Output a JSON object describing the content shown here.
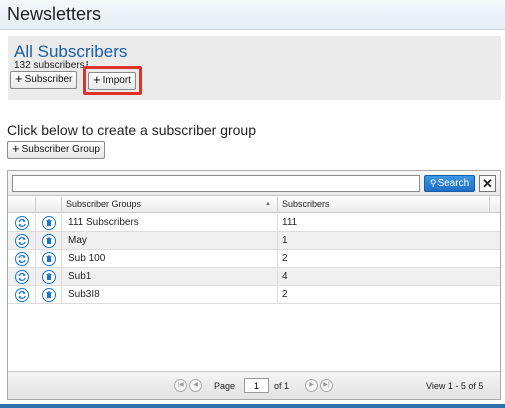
{
  "header": {
    "title": "Newsletters"
  },
  "panel": {
    "title": "All Subscribers",
    "count_text": "132 subscribers",
    "add_subscriber_label": "Subscriber",
    "import_label": "Import"
  },
  "group_section": {
    "heading": "Click below to create a subscriber group",
    "add_group_label": "Subscriber Group"
  },
  "grid": {
    "search_value": "",
    "search_label": "Search",
    "clear_label": "✕",
    "columns": {
      "groups": "Subscriber Groups",
      "subscribers": "Subscribers"
    },
    "rows": [
      {
        "group": "111 Subscribers",
        "count": "111"
      },
      {
        "group": "May",
        "count": "1"
      },
      {
        "group": "Sub 100",
        "count": "2"
      },
      {
        "group": "Sub1",
        "count": "4"
      },
      {
        "group": "Sub3I8",
        "count": "2"
      }
    ],
    "pager": {
      "page_label": "Page",
      "page_value": "1",
      "of_label": "of 1",
      "view_label": "View 1 - 5 of 5"
    }
  },
  "icons": {
    "row_action_1": "refresh-icon",
    "row_action_2": "delete-icon"
  },
  "colors": {
    "accent": "#1a5ea8",
    "highlight": "#e0322a",
    "search_button": "#1e6fc4"
  }
}
